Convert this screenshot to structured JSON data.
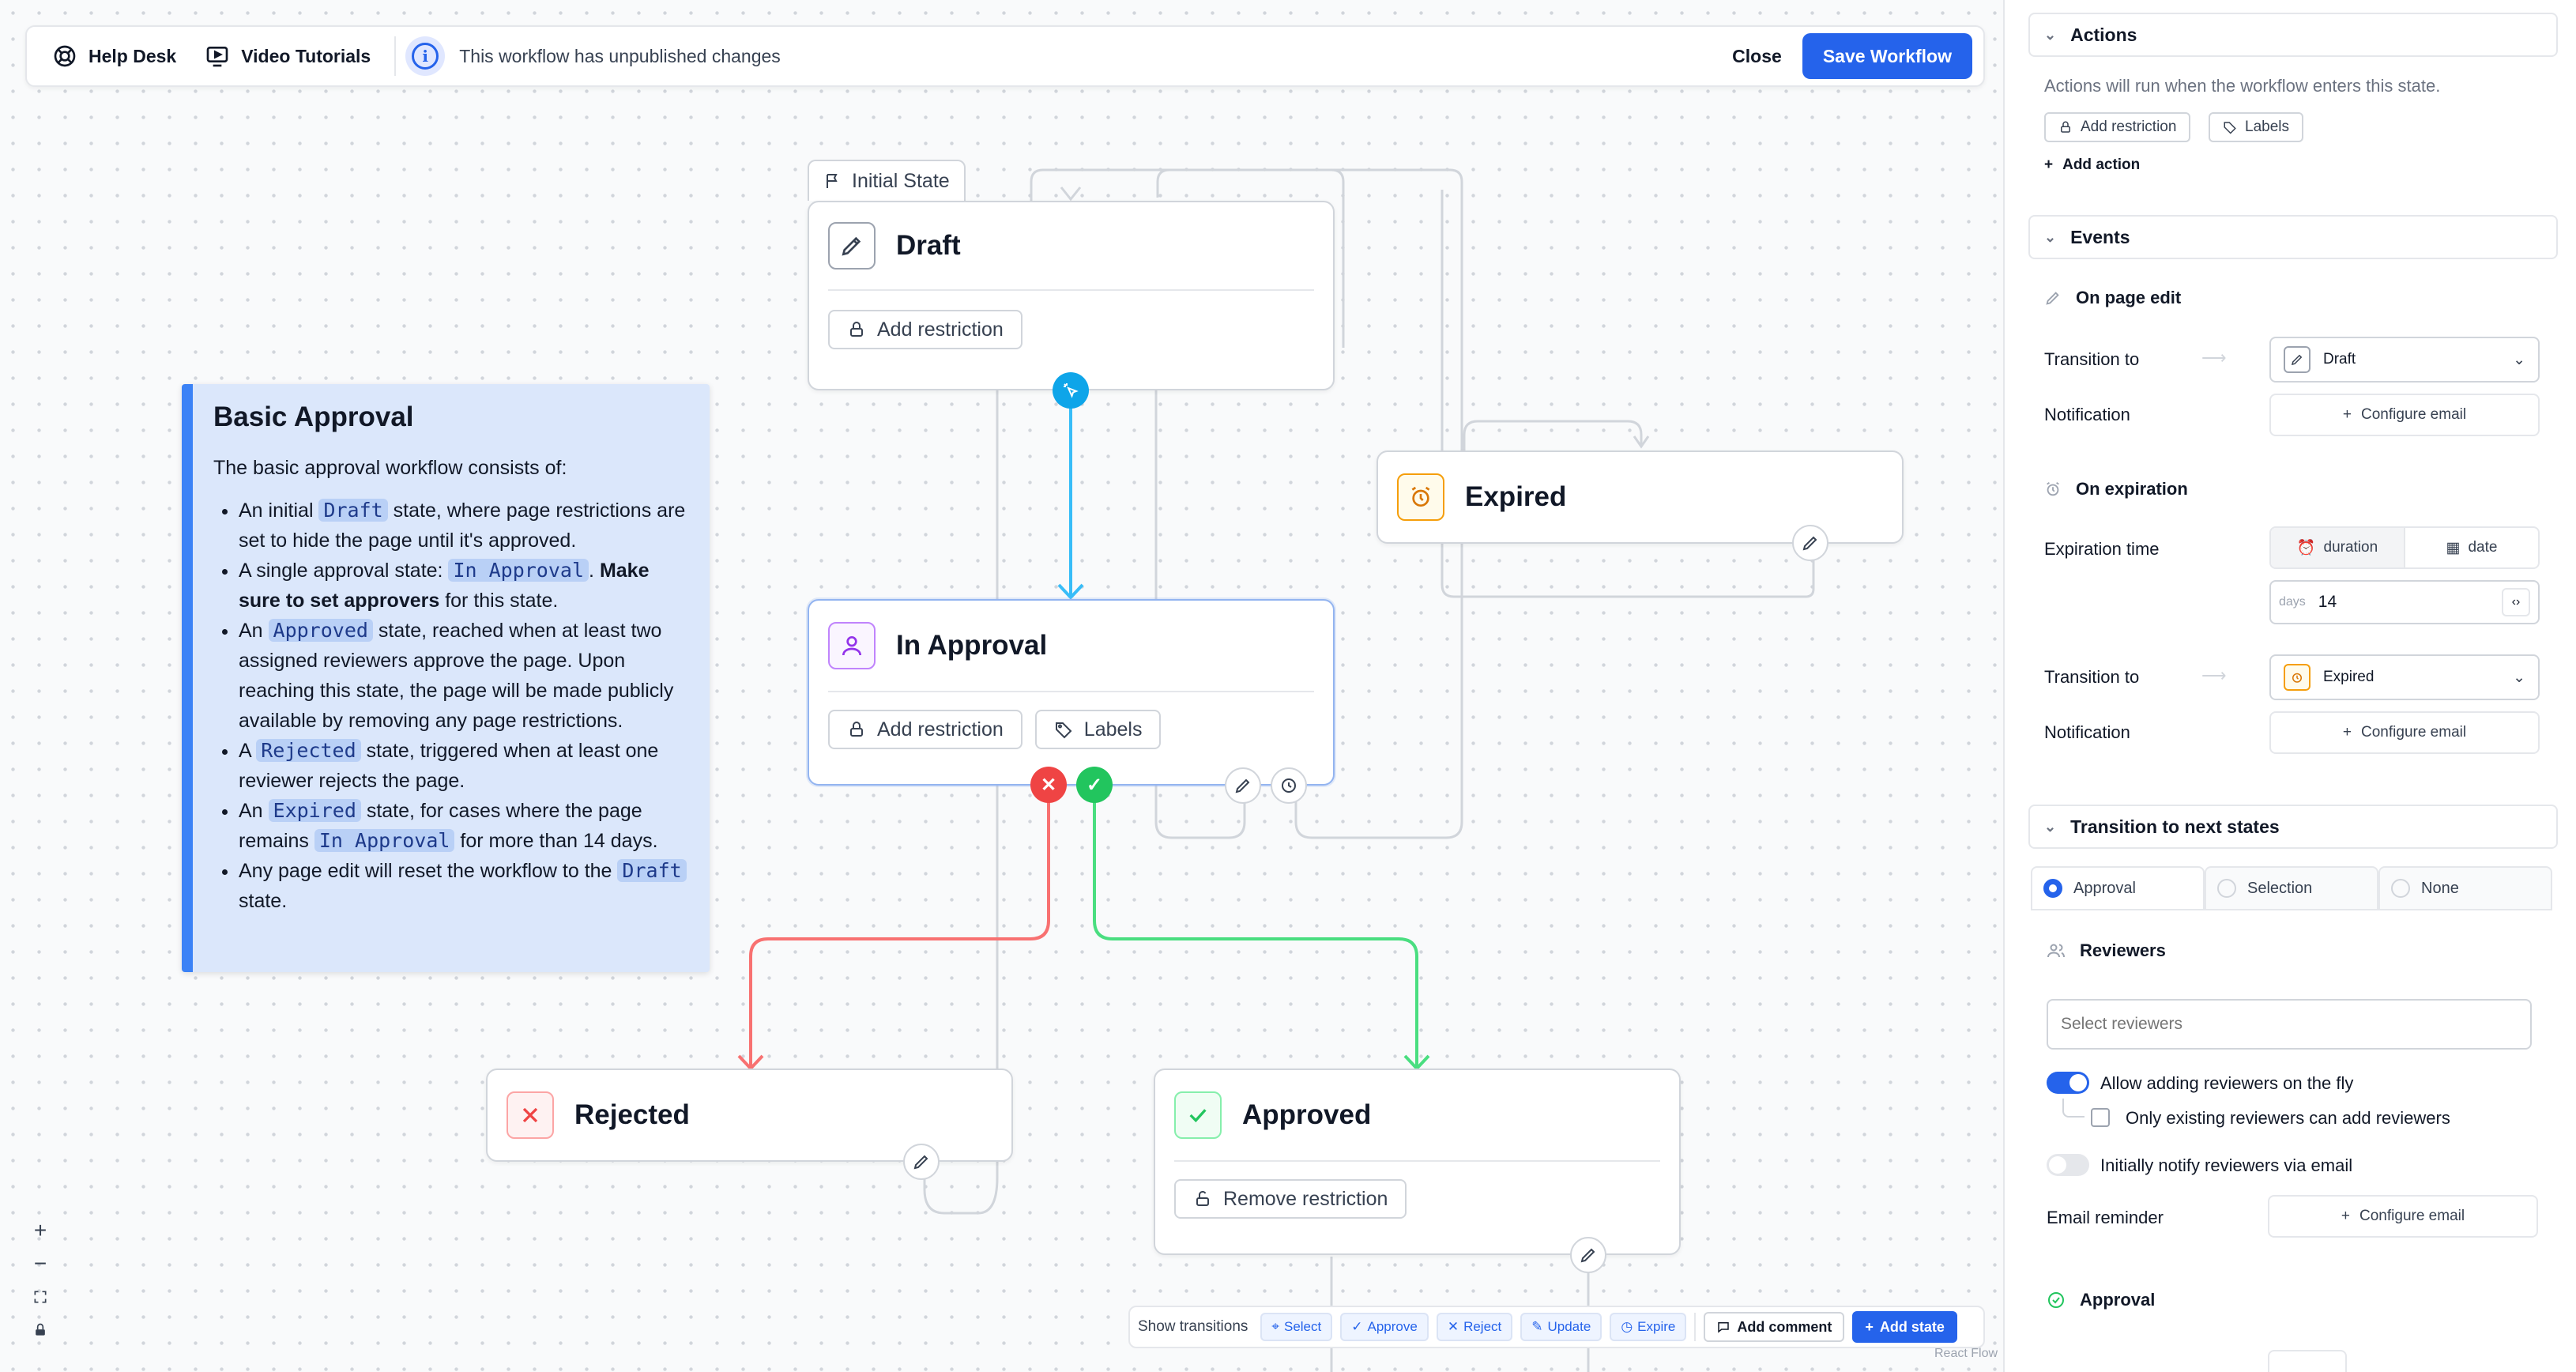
{
  "topbar": {
    "help_desk": "Help Desk",
    "video_tutorials": "Video Tutorials",
    "unpublished_message": "This workflow has unpublished changes",
    "close": "Close",
    "save": "Save Workflow"
  },
  "note": {
    "title": "Basic Approval",
    "intro": "The basic approval workflow consists of:",
    "items": [
      {
        "pre": "An initial ",
        "code": "Draft",
        "post": " state, where page restrictions are set to hide the page until it's approved."
      },
      {
        "pre": "A single approval state: ",
        "code": "In Approval",
        "mid": ". ",
        "bold": "Make sure to set approvers",
        "post": " for this state."
      },
      {
        "pre": "An ",
        "code": "Approved",
        "post": " state, reached when at least two assigned reviewers approve the page. Upon reaching this state, the page will be made publicly available by removing any page restrictions."
      },
      {
        "pre": "A ",
        "code": "Rejected",
        "post": " state, triggered when at least one reviewer rejects the page."
      },
      {
        "pre": "An ",
        "code": "Expired",
        "mid": " state, for cases where the page remains ",
        "code2": "In Approval",
        "post": " for more than 14 days."
      },
      {
        "pre": "Any page edit will reset the workflow to the ",
        "code": "Draft",
        "post": " state."
      }
    ]
  },
  "nodes": {
    "initial_label": "Initial State",
    "draft": {
      "title": "Draft",
      "chip1": "Add restriction"
    },
    "in_approval": {
      "title": "In Approval",
      "chip1": "Add restriction",
      "chip2": "Labels"
    },
    "expired": {
      "title": "Expired"
    },
    "rejected": {
      "title": "Rejected"
    },
    "approved": {
      "title": "Approved",
      "chip1": "Remove restriction"
    }
  },
  "zoom": {
    "plus": "+",
    "minus": "−"
  },
  "bottombar": {
    "show_transitions": "Show transitions",
    "select": "Select",
    "approve": "Approve",
    "reject": "Reject",
    "update": "Update",
    "expire": "Expire",
    "add_comment": "Add comment",
    "add_state": "Add state",
    "attribution": "React Flow"
  },
  "panel": {
    "actions": {
      "title": "Actions",
      "description": "Actions will run when the workflow enters this state.",
      "add_restriction": "Add restriction",
      "labels": "Labels",
      "add_action": "Add action"
    },
    "events": {
      "title": "Events",
      "on_page_edit": "On page edit",
      "transition_to": "Transition to",
      "draft": "Draft",
      "notification": "Notification",
      "configure_email": "Configure email",
      "on_expiration": "On expiration",
      "expiration_time": "Expiration time",
      "duration": "duration",
      "date": "date",
      "days_unit": "days",
      "days_value": "14",
      "expired": "Expired"
    },
    "transitions": {
      "title": "Transition to next states",
      "tab_approval": "Approval",
      "tab_selection": "Selection",
      "tab_none": "None",
      "reviewers": "Reviewers",
      "select_placeholder": "Select reviewers",
      "allow_adding": "Allow adding reviewers on the fly",
      "only_existing": "Only existing reviewers can add reviewers",
      "notify_email": "Initially notify reviewers via email",
      "email_reminder": "Email reminder",
      "configure_email": "Configure email",
      "approval": "Approval"
    }
  },
  "colors": {
    "accent": "#2563eb",
    "approve": "#22c55e",
    "reject": "#ef4444",
    "select": "#0ea5e9",
    "note_bg": "#dbe7fb"
  }
}
